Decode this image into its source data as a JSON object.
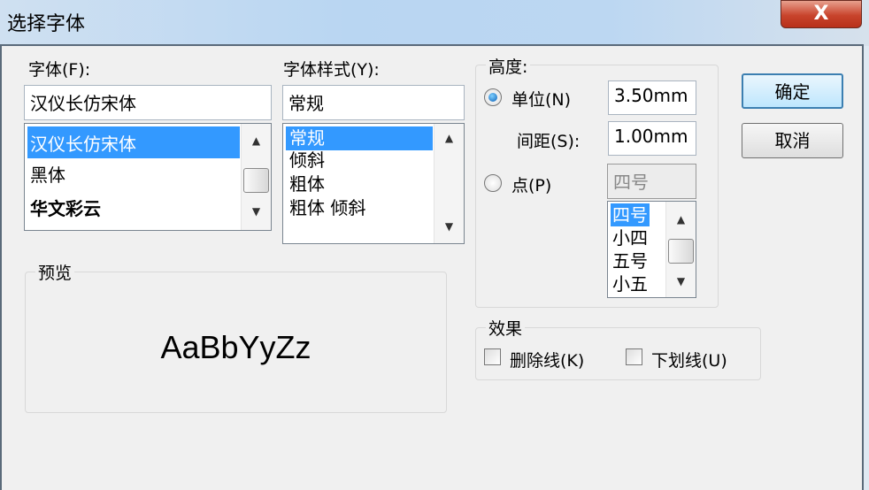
{
  "window": {
    "title": "选择字体",
    "close_label": "X"
  },
  "font": {
    "label": "字体(F):",
    "value": "汉仪长仿宋体",
    "items": [
      "汉仪长仿宋体",
      "黑体",
      "华文彩云"
    ]
  },
  "style": {
    "label": "字体样式(Y):",
    "value": "常规",
    "items": [
      "常规",
      "倾斜",
      "粗体",
      "粗体 倾斜"
    ]
  },
  "height": {
    "legend": "高度:",
    "unit_label": "单位(N)",
    "unit_value": "3.50mm",
    "spacing_label": "间距(S):",
    "spacing_value": "1.00mm",
    "point_label": "点(P)",
    "point_value": "四号",
    "point_items": [
      "四号",
      "小四",
      "五号",
      "小五"
    ]
  },
  "preview": {
    "legend": "预览",
    "sample": "AaBbYyZz"
  },
  "effects": {
    "legend": "效果",
    "strike_label": "删除线(K)",
    "underline_label": "下划线(U)"
  },
  "buttons": {
    "ok": "确定",
    "cancel": "取消"
  }
}
